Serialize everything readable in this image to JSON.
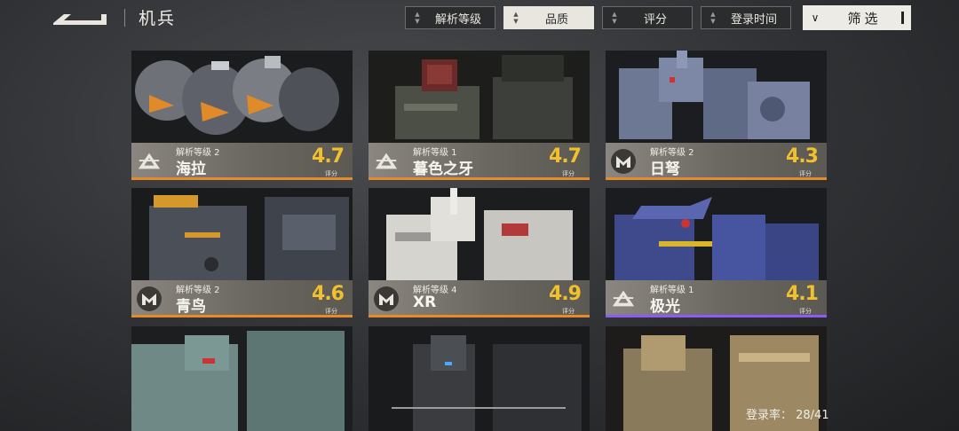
{
  "header": {
    "title": "机兵",
    "sort_buttons": [
      {
        "label": "解析等级",
        "active": false
      },
      {
        "label": "品质",
        "active": true
      },
      {
        "label": "评分",
        "active": false
      },
      {
        "label": "登录时间",
        "active": false
      }
    ],
    "filter_label": "筛选"
  },
  "mechs": [
    {
      "level": "解析等级 2",
      "name": "海拉",
      "score": "4.7",
      "score_label": "评分",
      "emblem": "triangle-emblem-icon",
      "rarity_color": "#e48b2a"
    },
    {
      "level": "解析等级 1",
      "name": "暮色之牙",
      "score": "4.7",
      "score_label": "评分",
      "emblem": "triangle-emblem-icon",
      "rarity_color": "#e48b2a"
    },
    {
      "level": "解析等级 2",
      "name": "日弩",
      "score": "4.3",
      "score_label": "评分",
      "emblem": "m-emblem-icon",
      "rarity_color": "#e48b2a"
    },
    {
      "level": "解析等级 2",
      "name": "青鸟",
      "score": "4.6",
      "score_label": "评分",
      "emblem": "m-emblem-icon",
      "rarity_color": "#e48b2a"
    },
    {
      "level": "解析等级 4",
      "name": "XR",
      "score": "4.9",
      "score_label": "评分",
      "emblem": "m-emblem-icon",
      "rarity_color": "#e48b2a"
    },
    {
      "level": "解析等级 1",
      "name": "极光",
      "score": "4.1",
      "score_label": "评分",
      "emblem": "triangle-emblem-icon",
      "rarity_color": "#8e5cf0"
    }
  ],
  "footer": {
    "login_rate": "登录率：  28/41"
  }
}
